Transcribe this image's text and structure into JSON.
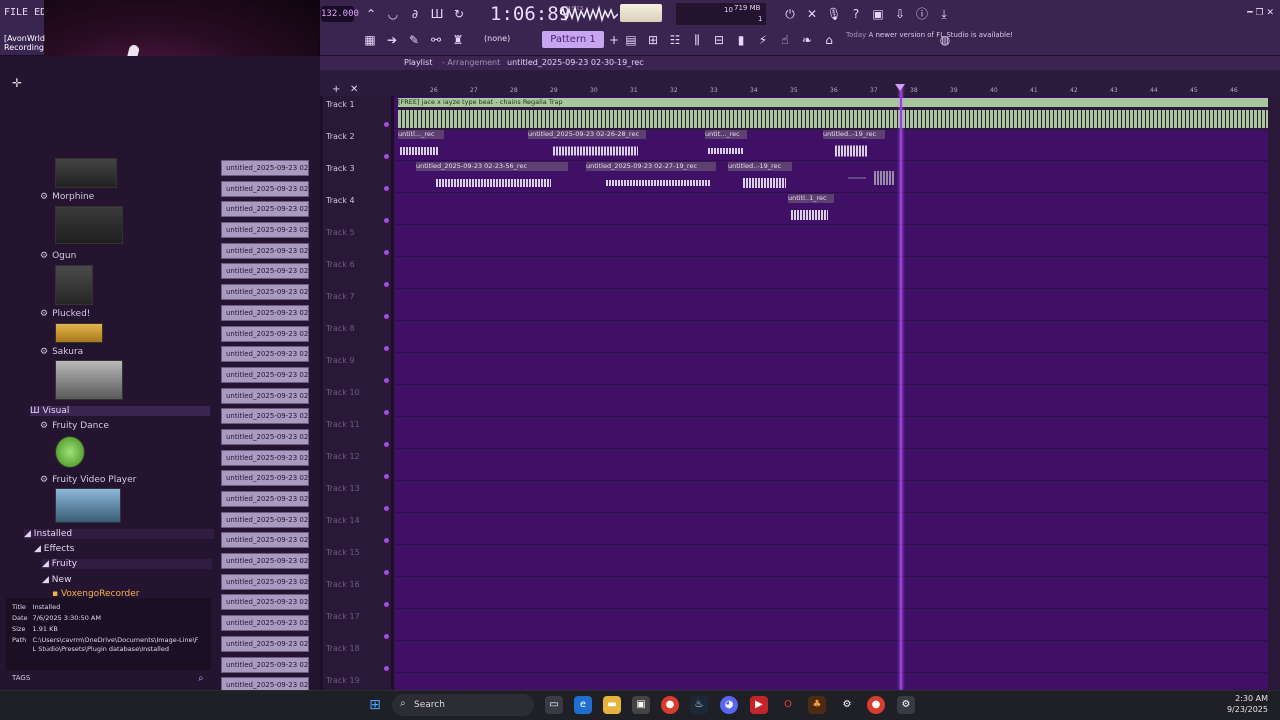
{
  "menu": {
    "file": "FILE",
    "edit": "EDIT"
  },
  "recording": {
    "user": "[AvonWrld",
    "status": "Recording"
  },
  "transport": {
    "tempo": "132.000",
    "time": "1:06:89",
    "time_unit": "M:S:CS",
    "pattern": "Pattern 1",
    "instrument": "(none)"
  },
  "cpu": {
    "polyphony": "10",
    "memory": "719 MB",
    "cpu": "1"
  },
  "news": {
    "day": "Today",
    "message": "A newer version of FL Studio is available!"
  },
  "playlist": {
    "title": "Playlist",
    "sep": "- Arrangement",
    "file": "untitled_2025-09-23 02-30-19_rec"
  },
  "ruler": [
    "26",
    "27",
    "28",
    "29",
    "30",
    "31",
    "32",
    "33",
    "34",
    "35",
    "36",
    "37",
    "38",
    "39",
    "40",
    "41",
    "42",
    "43",
    "44",
    "45",
    "46"
  ],
  "tracks": [
    "Track 1",
    "Track 2",
    "Track 3",
    "Track 4",
    "Track 5",
    "Track 6",
    "Track 7",
    "Track 8",
    "Track 9",
    "Track 10",
    "Track 11",
    "Track 12",
    "Track 13",
    "Track 14",
    "Track 15",
    "Track 16",
    "Track 17",
    "Track 18",
    "Track 19"
  ],
  "clips": {
    "t1": "[FREE] jace x iayze type beat - chains  Regalia Trap",
    "t2a": "untitl..._rec",
    "t2b": "untitled_2025-09-23 02-26-28_rec",
    "t2c": "untit..._rec",
    "t2d": "untitled..-19_rec",
    "t3a": "untitled_2025-09-23 02-23-56_rec",
    "t3b": "untitled_2025-09-23 02-27-19_rec",
    "t3c": "untitled..-19_rec",
    "t4a": "untitl..1_rec"
  },
  "browser": {
    "plugins": [
      {
        "name": "Morphine"
      },
      {
        "name": "Ogun"
      },
      {
        "name": "Plucked!"
      },
      {
        "name": "Sakura"
      }
    ],
    "visual": "Visual",
    "visual_items": [
      {
        "name": "Fruity Dance"
      },
      {
        "name": "Fruity Video Player"
      }
    ],
    "installed": "Installed",
    "effects": "Effects",
    "fruity": "Fruity",
    "new": "New",
    "voxengo": "VoxengoRecorder"
  },
  "info": {
    "title_label": "Title",
    "title": "Installed",
    "date_label": "Date",
    "date": "7/6/2025 3:30:50 AM",
    "size_label": "Size",
    "size": "1.91 KB",
    "path_label": "Path",
    "path": "C:\\Users\\cavrm\\OneDrive\\Documents\\Image-Line\\FL Studio\\Presets\\Plugin database\\Installed"
  },
  "tags_label": "TAGS",
  "clip_list_item": "untitled_2025-09-23 02-...",
  "clip_list_last": "untitled_2025-09-23 02-...",
  "taskbar": {
    "search": "Search",
    "time": "2:30 AM",
    "date": "9/23/2025"
  }
}
